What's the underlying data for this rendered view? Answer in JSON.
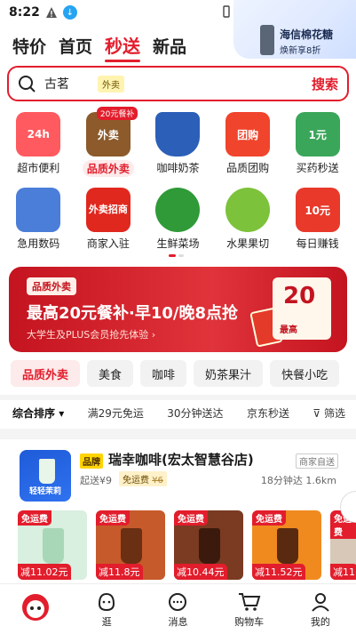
{
  "status_bar": {
    "time": "8:22"
  },
  "promo_corner": {
    "title": "海信棉花糖",
    "subtitle": "焕新享8折"
  },
  "top_tabs": [
    "特价",
    "首页",
    "秒送",
    "新品"
  ],
  "search": {
    "value": "古茗",
    "chip": "外卖",
    "button": "搜索"
  },
  "categories_row1": [
    {
      "label": "超市便利",
      "icon": "24h-bag-icon",
      "color": "#ff5a5f"
    },
    {
      "label": "品质外卖",
      "icon": "takeout-bag-icon",
      "color": "#8c5a2b",
      "badge": "20元餐补",
      "selected": true
    },
    {
      "label": "咖啡奶茶",
      "icon": "coffee-cup-icon",
      "color": "#2b5fb8"
    },
    {
      "label": "品质团购",
      "icon": "group-buy-icon",
      "color": "#f0442c"
    },
    {
      "label": "买药秒送",
      "icon": "medicine-box-icon",
      "color": "#3aa65a"
    }
  ],
  "categories_row2": [
    {
      "label": "急用数码",
      "icon": "cable-icon",
      "color": "#4a7ed9"
    },
    {
      "label": "商家入驻",
      "icon": "merchant-join-icon",
      "color": "#e0281e"
    },
    {
      "label": "生鲜菜场",
      "icon": "broccoli-icon",
      "color": "#2f9a37"
    },
    {
      "label": "水果果切",
      "icon": "grapes-icon",
      "color": "#7cc23a"
    },
    {
      "label": "每日赚钱",
      "icon": "cash-icon",
      "color": "#e8392b"
    }
  ],
  "category_icon_text": {
    "takeout": "外卖",
    "group": "团购",
    "merchant": "外卖招商",
    "cash": "10元",
    "medicine": "1元",
    "h24": "24h"
  },
  "banner": {
    "tag": "品质外卖",
    "headline": "最高20元餐补·早10/晚8点抢",
    "sub": "大学生及PLUS会员抢先体验",
    "voucher_amount": "20",
    "voucher_label": "最高"
  },
  "chips": [
    "品质外卖",
    "美食",
    "咖啡",
    "奶茶果汁",
    "快餐小吃"
  ],
  "filters": [
    "综合排序",
    "满29元免运",
    "30分钟送达",
    "京东秒送",
    "筛选"
  ],
  "store": {
    "brand": "品牌",
    "name": "瑞幸咖啡(宏太智慧谷店)",
    "self_delivery": "商家自送",
    "min_order": "起送¥9",
    "free_delivery": "免运费",
    "original_fee": "¥6",
    "eta": "18分钟达",
    "distance": "1.6km",
    "logo_text": "轻轻茉莉",
    "products": [
      {
        "tag": "免运费",
        "discount": "减11.02元",
        "color": "#d9efe0"
      },
      {
        "tag": "免运费",
        "discount": "减11.8元",
        "color": "#c65a2a"
      },
      {
        "tag": "免运费",
        "discount": "减10.44元",
        "color": "#7a3b22"
      },
      {
        "tag": "免运费",
        "discount": "减11.52元",
        "color": "#f08a1f"
      },
      {
        "tag": "免运费",
        "discount": "减11",
        "color": "#d7c8b8"
      }
    ]
  },
  "bottom_nav": [
    "逛",
    "消息",
    "购物车",
    "我的"
  ]
}
